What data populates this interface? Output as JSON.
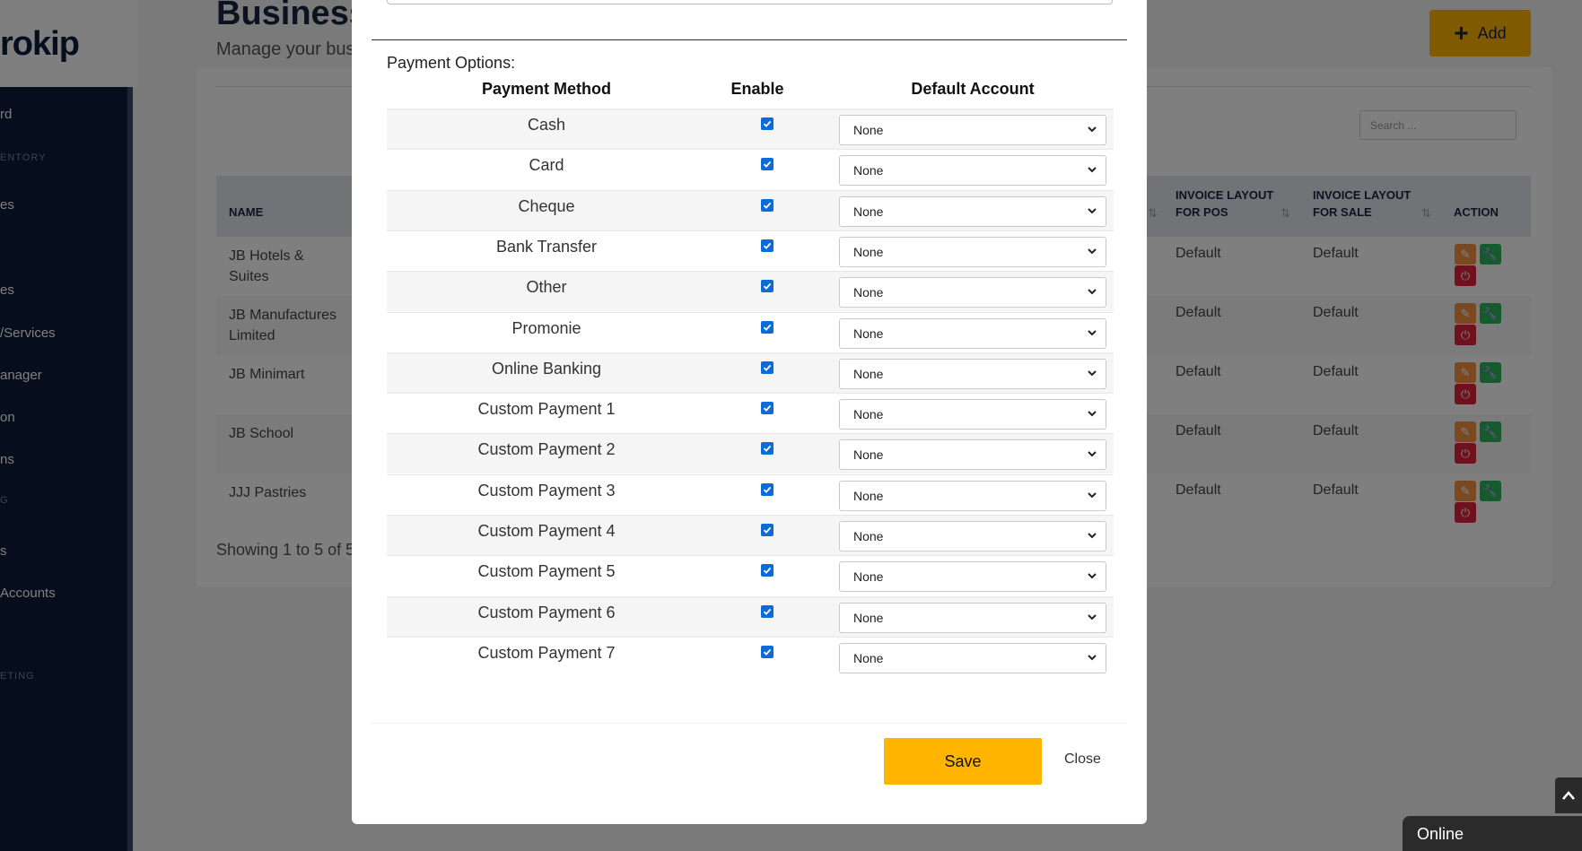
{
  "app": {
    "logo_text": "rokip"
  },
  "sidebar": {
    "items": [
      {
        "label": "rd",
        "type": "item"
      },
      {
        "label": "ENTORY",
        "type": "header"
      },
      {
        "label": "es",
        "type": "item"
      },
      {
        "label": "es",
        "type": "item"
      },
      {
        "label": "/Services",
        "type": "item"
      },
      {
        "label": "anager",
        "type": "item"
      },
      {
        "label": "on",
        "type": "item"
      },
      {
        "label": "ns",
        "type": "item"
      },
      {
        "label": "G",
        "type": "header"
      },
      {
        "label": "s",
        "type": "item"
      },
      {
        "label": " Accounts",
        "type": "item"
      },
      {
        "label": "ETING",
        "type": "header"
      }
    ]
  },
  "page": {
    "title": "Business",
    "subtitle": "Manage your bus",
    "add_label": "Add",
    "search_placeholder": "Search ...",
    "showing_text": "Showing 1 to 5 of 5"
  },
  "table": {
    "headers": {
      "name": "NAME",
      "invoice_pos_line1": "INVOICE LAYOUT",
      "invoice_pos_line2": "FOR POS",
      "invoice_sale_line1": "INVOICE LAYOUT",
      "invoice_sale_line2": "FOR SALE",
      "action": "ACTION"
    },
    "rows": [
      {
        "name": "JB Hotels & Suites",
        "pos": "Default",
        "sale": "Default"
      },
      {
        "name": "JB Manufactures Limited",
        "pos": "Default",
        "sale": "Default"
      },
      {
        "name": "JB Minimart",
        "pos": "Default",
        "sale": "Default"
      },
      {
        "name": "JB School",
        "pos": "Default",
        "sale": "Default"
      },
      {
        "name": "JJJ Pastries",
        "pos": "Default",
        "sale": "Default"
      }
    ]
  },
  "modal": {
    "payment_options_label": "Payment Options:",
    "columns": {
      "method": "Payment Method",
      "enable": "Enable",
      "account": "Default Account"
    },
    "methods": [
      {
        "name": "Cash",
        "enabled": true,
        "account": "None"
      },
      {
        "name": "Card",
        "enabled": true,
        "account": "None"
      },
      {
        "name": "Cheque",
        "enabled": true,
        "account": "None"
      },
      {
        "name": "Bank Transfer",
        "enabled": true,
        "account": "None"
      },
      {
        "name": "Other",
        "enabled": true,
        "account": "None"
      },
      {
        "name": "Promonie",
        "enabled": true,
        "account": "None"
      },
      {
        "name": "Online Banking",
        "enabled": true,
        "account": "None"
      },
      {
        "name": "Custom Payment 1",
        "enabled": true,
        "account": "None"
      },
      {
        "name": "Custom Payment 2",
        "enabled": true,
        "account": "None"
      },
      {
        "name": "Custom Payment 3",
        "enabled": true,
        "account": "None"
      },
      {
        "name": "Custom Payment 4",
        "enabled": true,
        "account": "None"
      },
      {
        "name": "Custom Payment 5",
        "enabled": true,
        "account": "None"
      },
      {
        "name": "Custom Payment 6",
        "enabled": true,
        "account": "None"
      },
      {
        "name": "Custom Payment 7",
        "enabled": true,
        "account": "None"
      }
    ],
    "save_label": "Save",
    "close_label": "Close"
  },
  "widgets": {
    "online_label": "Online"
  },
  "colors": {
    "accent": "#ffb400",
    "sidebar": "#0d1a3a",
    "checkbox": "#0b6bd8"
  }
}
